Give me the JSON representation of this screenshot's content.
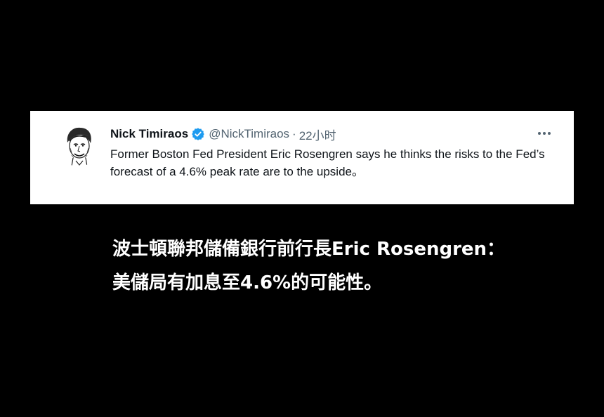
{
  "tweet": {
    "author_name": "Nick Timiraos",
    "handle": "@NickTimiraos",
    "separator": "·",
    "timestamp": "22小时",
    "text": "Former Boston Fed President Eric Rosengren says he thinks the risks to the Fed’s forecast of a 4.6% peak rate are to the upside。",
    "verified_icon": "verified-badge-icon",
    "more_icon": "more-options-icon",
    "avatar_icon": "avatar-sketch-portrait",
    "verified_color": "#1d9bf0"
  },
  "caption": {
    "line1": "波士頓聯邦儲備銀行前行長Eric Rosengren：",
    "line2": "美儲局有加息至4.6%的可能性。"
  },
  "colors": {
    "background": "#000000",
    "card": "#ffffff",
    "text_primary": "#0f1419",
    "text_secondary": "#536471",
    "caption": "#ffffff"
  }
}
